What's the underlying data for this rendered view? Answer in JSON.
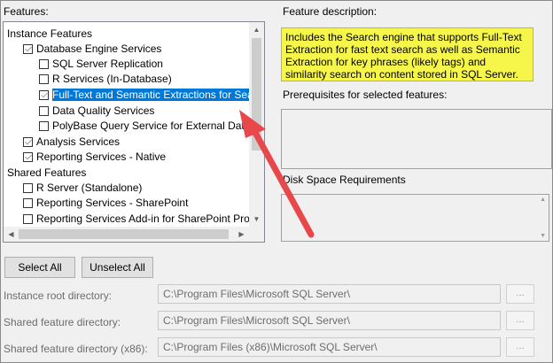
{
  "features_label": "Features:",
  "tree": {
    "items": [
      {
        "label": "Instance Features",
        "checkbox": false,
        "checked": false,
        "selected": false
      },
      {
        "label": "Database Engine Services",
        "checkbox": true,
        "checked": true,
        "selected": false
      },
      {
        "label": "SQL Server Replication",
        "checkbox": true,
        "checked": false,
        "selected": false
      },
      {
        "label": "R Services (In-Database)",
        "checkbox": true,
        "checked": false,
        "selected": false
      },
      {
        "label": "Full-Text and Semantic Extractions for Search",
        "checkbox": true,
        "checked": true,
        "selected": true
      },
      {
        "label": "Data Quality Services",
        "checkbox": true,
        "checked": false,
        "selected": false
      },
      {
        "label": "PolyBase Query Service for External Data",
        "checkbox": true,
        "checked": false,
        "selected": false
      },
      {
        "label": "Analysis Services",
        "checkbox": true,
        "checked": true,
        "selected": false
      },
      {
        "label": "Reporting Services - Native",
        "checkbox": true,
        "checked": true,
        "selected": false
      },
      {
        "label": "Shared Features",
        "checkbox": false,
        "checked": false,
        "selected": false
      },
      {
        "label": "R Server (Standalone)",
        "checkbox": true,
        "checked": false,
        "selected": false
      },
      {
        "label": "Reporting Services - SharePoint",
        "checkbox": true,
        "checked": false,
        "selected": false
      },
      {
        "label": "Reporting Services Add-in for SharePoint Product",
        "checkbox": true,
        "checked": false,
        "selected": false
      }
    ]
  },
  "feature_description": {
    "label": "Feature description:",
    "text": "Includes the Search engine that supports Full-Text Extraction for fast text search as well as Semantic Extraction for key phrases (likely tags) and similarity search on content stored in SQL Server."
  },
  "prerequisites_label": "Prerequisites for selected features:",
  "disk_space_label": "Disk Space Requirements",
  "buttons": {
    "select_all": "Select All",
    "unselect_all": "Unselect All",
    "browse": "..."
  },
  "directories": [
    {
      "label": "Instance root directory:",
      "value": "C:\\Program Files\\Microsoft SQL Server\\"
    },
    {
      "label": "Shared feature directory:",
      "value": "C:\\Program Files\\Microsoft SQL Server\\"
    },
    {
      "label": "Shared feature directory (x86):",
      "value": "C:\\Program Files (x86)\\Microsoft SQL Server\\"
    }
  ],
  "colors": {
    "selection": "#0078d7",
    "highlight": "#f6f64a",
    "annotation_arrow": "#e8474b"
  },
  "icons": {
    "scroll_up": "scroll-up-arrow-icon",
    "scroll_down": "scroll-down-arrow-icon",
    "scroll_left": "scroll-left-arrow-icon",
    "scroll_right": "scroll-right-arrow-icon",
    "annotation": "red-arrow-icon"
  }
}
